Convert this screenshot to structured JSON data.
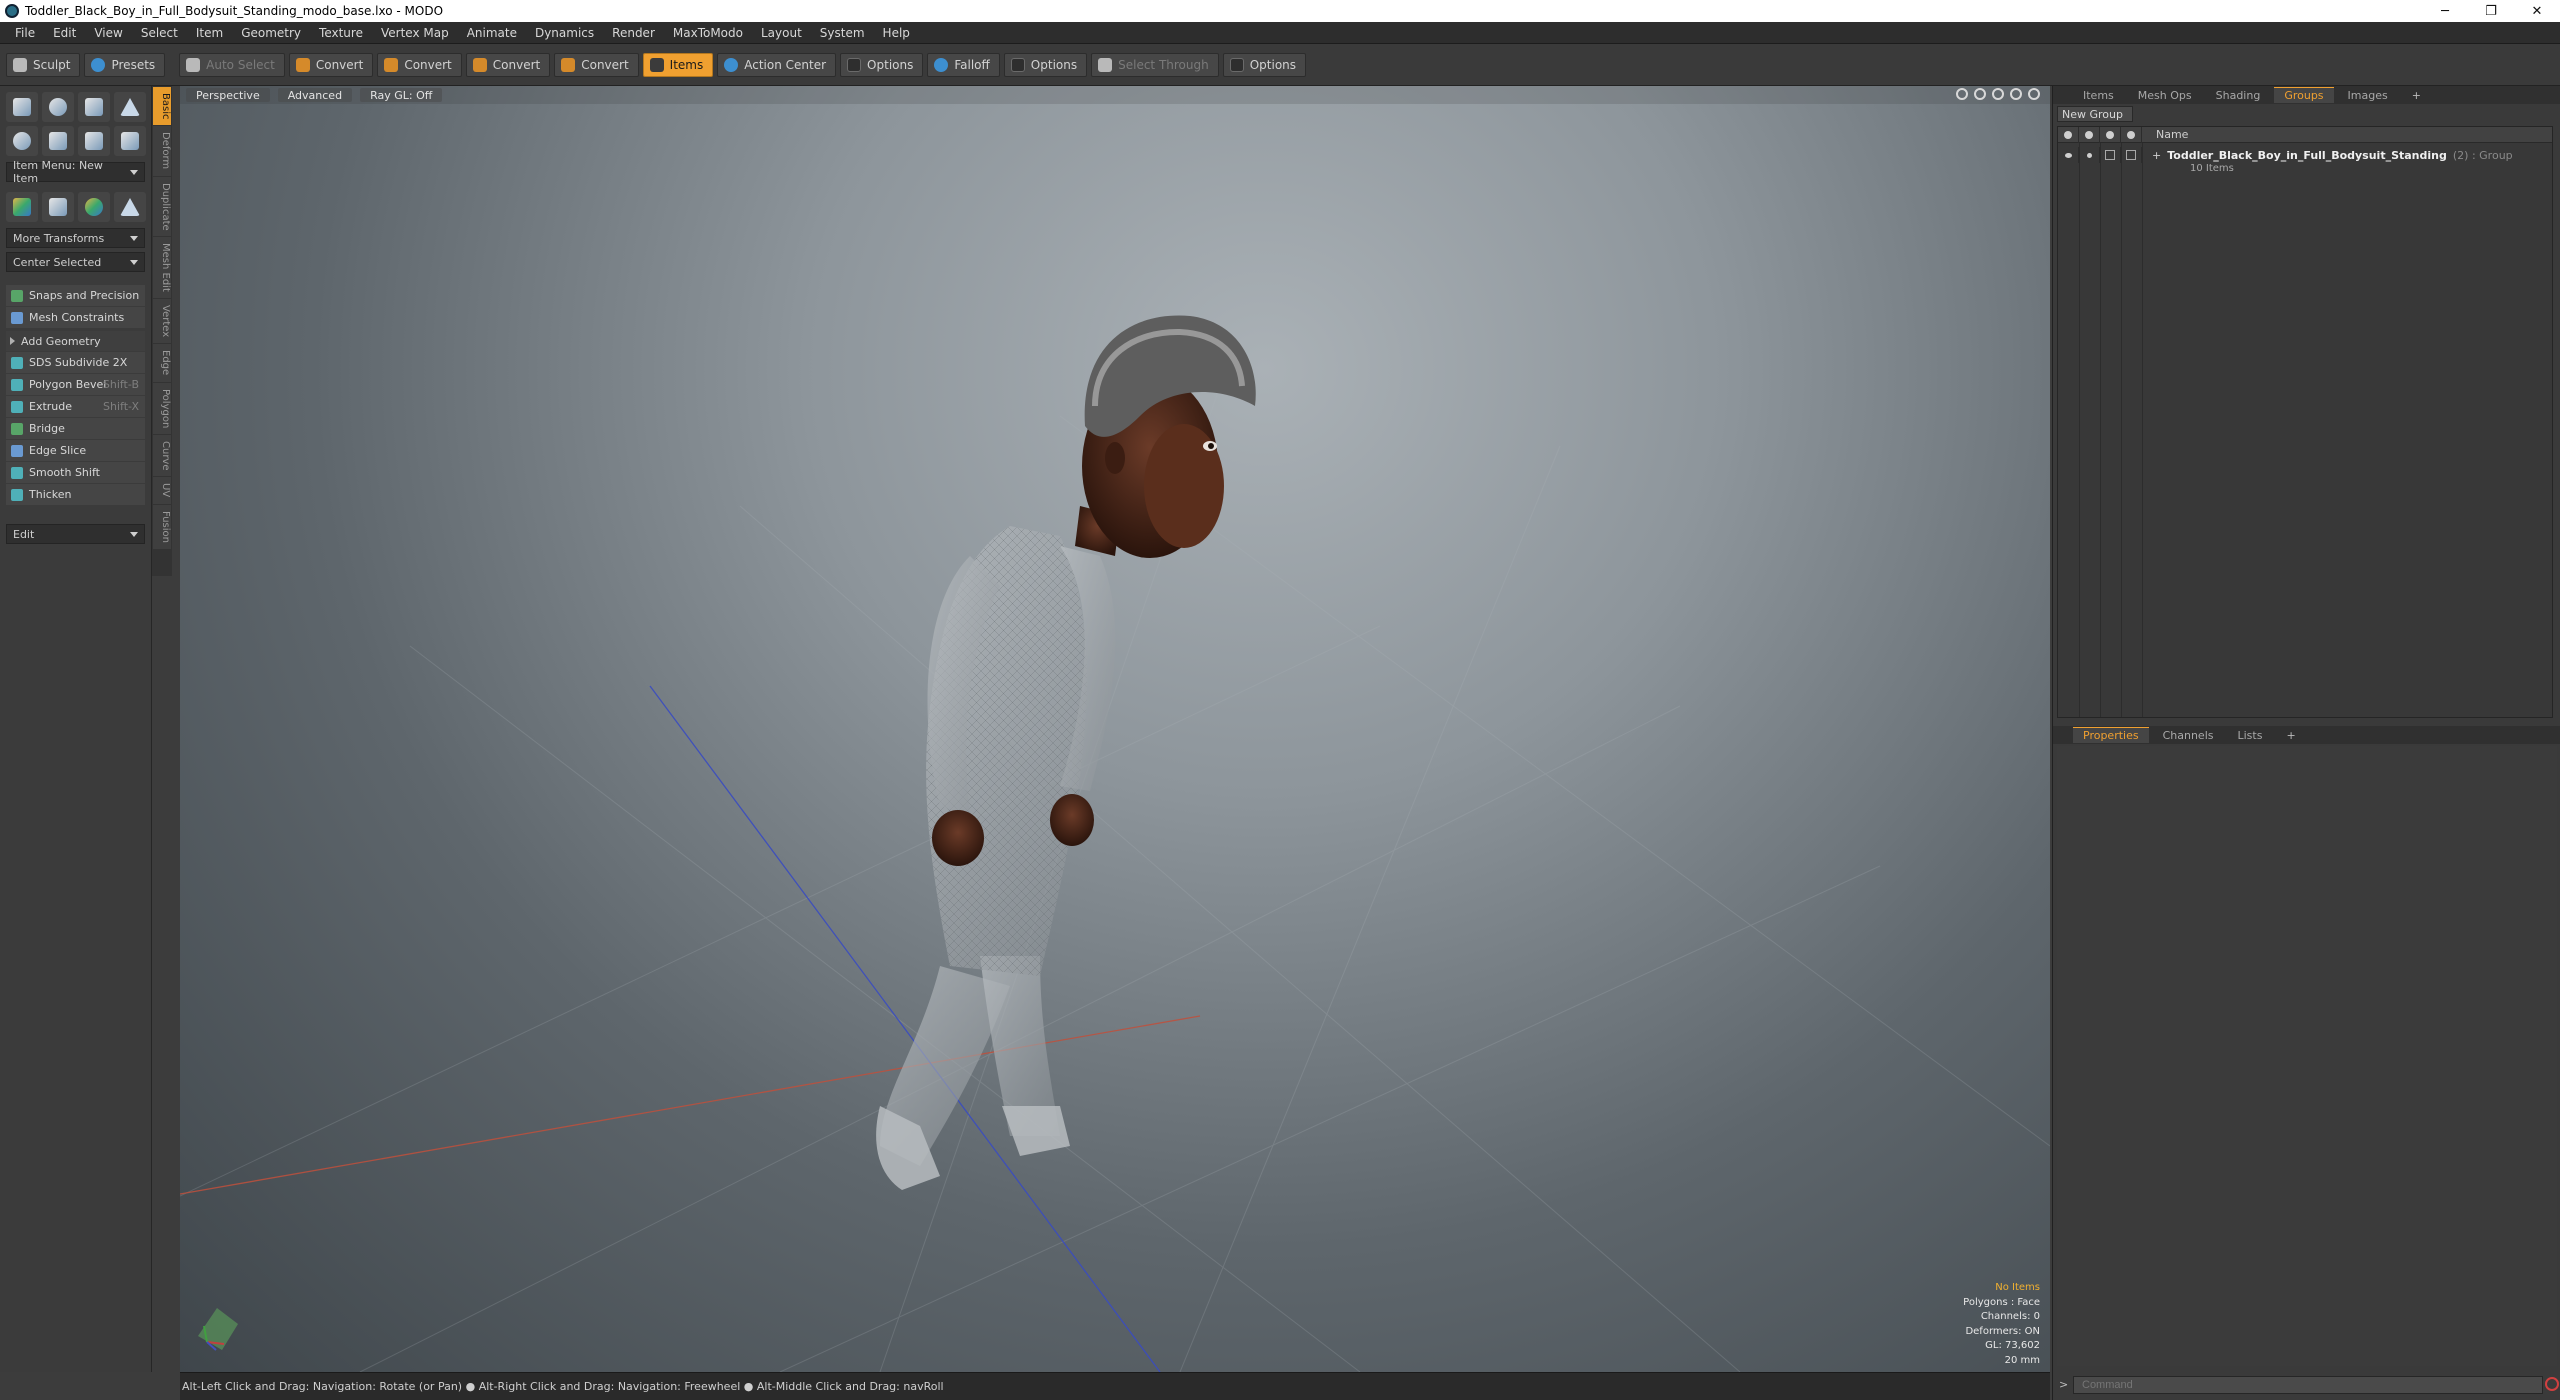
{
  "window": {
    "title": "Toddler_Black_Boy_in_Full_Bodysuit_Standing_modo_base.lxo - MODO",
    "minimize": "─",
    "maximize": "❐",
    "close": "✕"
  },
  "menu": [
    "File",
    "Edit",
    "View",
    "Select",
    "Item",
    "Geometry",
    "Texture",
    "Vertex Map",
    "Animate",
    "Dynamics",
    "Render",
    "MaxToModo",
    "Layout",
    "System",
    "Help"
  ],
  "toolbar": {
    "sculpt": "Sculpt",
    "presets": "Presets",
    "auto_select": "Auto Select",
    "convert1": "Convert",
    "convert2": "Convert",
    "convert3": "Convert",
    "convert4": "Convert",
    "items": "Items",
    "action_center": "Action Center",
    "options1": "Options",
    "falloff": "Falloff",
    "options2": "Options",
    "select_through": "Select Through",
    "options3": "Options"
  },
  "left_panel": {
    "item_menu": "Item Menu: New Item",
    "more_transforms": "More Transforms",
    "center_selected": "Center Selected",
    "snaps": "Snaps and Precision",
    "mesh_constraints": "Mesh Constraints",
    "add_geometry": "Add Geometry",
    "tools": [
      {
        "label": "SDS Subdivide 2X",
        "shortcut": ""
      },
      {
        "label": "Polygon Bevel",
        "shortcut": "Shift-B"
      },
      {
        "label": "Extrude",
        "shortcut": "Shift-X"
      },
      {
        "label": "Bridge",
        "shortcut": ""
      },
      {
        "label": "Edge Slice",
        "shortcut": ""
      },
      {
        "label": "Smooth Shift",
        "shortcut": ""
      },
      {
        "label": "Thicken",
        "shortcut": ""
      }
    ],
    "edit": "Edit"
  },
  "vertical_tabs": [
    "Basic",
    "Deform",
    "Duplicate",
    "Mesh Edit",
    "Vertex",
    "Edge",
    "Polygon",
    "Curve",
    "UV",
    "Fusion"
  ],
  "viewport": {
    "tabs": [
      "Perspective",
      "Advanced",
      "Ray GL: Off"
    ],
    "info": {
      "no_items": "No Items",
      "polygons": "Polygons : Face",
      "channels": "Channels: 0",
      "deformers": "Deformers: ON",
      "gl": "GL: 73,602",
      "scale": "20 mm"
    }
  },
  "status_bar": "Alt-Left Click and Drag: Navigation: Rotate (or Pan) ● Alt-Right Click and Drag: Navigation: Freewheel ● Alt-Middle Click and Drag: navRoll",
  "right_panel": {
    "top_tabs": [
      "Items",
      "Mesh Ops",
      "Shading",
      "Groups",
      "Images",
      "+"
    ],
    "new_group": "New Group",
    "name_header": "Name",
    "group_name": "Toddler_Black_Boy_in_Full_Bodysuit_Standing",
    "group_type": "(2) : Group",
    "group_sub": "10 Items",
    "bottom_tabs": [
      "Properties",
      "Channels",
      "Lists",
      "+"
    ],
    "command_placeholder": "Command",
    "command_prompt": ">"
  }
}
